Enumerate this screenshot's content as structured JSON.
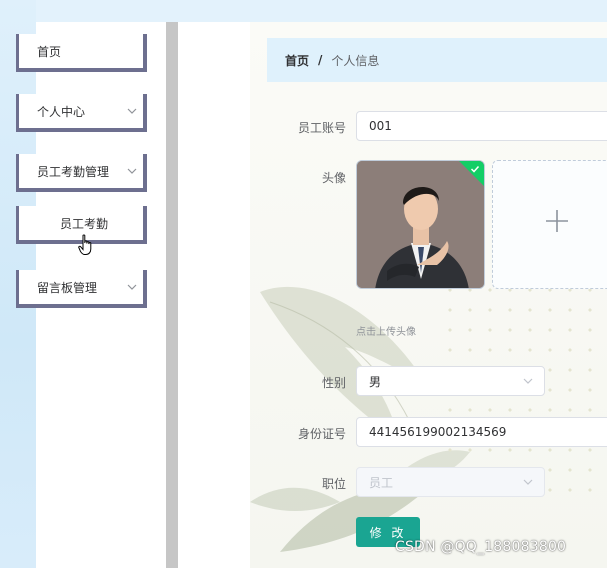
{
  "sidebar": {
    "items": [
      {
        "label": "首页"
      },
      {
        "label": "个人中心"
      },
      {
        "label": "员工考勤管理"
      },
      {
        "label": "员工考勤"
      },
      {
        "label": "留言板管理"
      }
    ]
  },
  "breadcrumb": {
    "home": "首页",
    "separator": "/",
    "current": "个人信息"
  },
  "form": {
    "account": {
      "label": "员工账号",
      "value": "001"
    },
    "avatar": {
      "label": "头像",
      "tip": "点击上传头像"
    },
    "gender": {
      "label": "性别",
      "value": "男"
    },
    "id_card": {
      "label": "身份证号",
      "value": "441456199002134569"
    },
    "position": {
      "label": "职位",
      "value": "员工"
    }
  },
  "actions": {
    "submit_label": "修 改"
  },
  "watermark": "CSDN @QQ_188083800",
  "colors": {
    "primary_button": "#1aa592",
    "breadcrumb_bg": "#dff1fc",
    "sidebar_border": "#6d6f8f",
    "upload_success": "#13ce66"
  },
  "icons": {
    "chevron": "chevron-down-icon",
    "cursor": "hand-pointer-icon",
    "upload": "plus-icon",
    "success": "check-icon"
  }
}
